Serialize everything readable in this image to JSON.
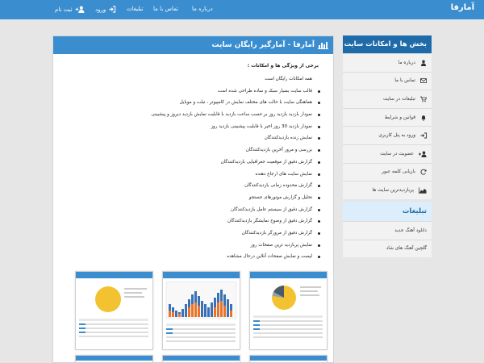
{
  "navbar": {
    "brand": "آمارفا",
    "links": [
      {
        "label": "درباره ما",
        "icon": "none"
      },
      {
        "label": "تماس با ما",
        "icon": "none"
      },
      {
        "label": "تبلیغات",
        "icon": "none"
      },
      {
        "label": "ورود",
        "icon": "sign-in-icon"
      },
      {
        "label": "ثبت نام",
        "icon": "user-plus-icon"
      }
    ]
  },
  "main": {
    "title": "آمارفا - آمارگیر رایگان سایت",
    "title_icon": "bar-chart-icon",
    "intro": "برخی از ویژگی ها و امکانات :",
    "features": [
      "همه امکانات رایگان است",
      "قالب سایت بسیار سبک و ساده طراحی شده است",
      "هماهنگی سایت با حالت های مختلف نمایش در کامپیوتر ، تبلت و موبایل",
      "نمودار بازدید بازدید روز بر حسب ساعت بازدید با قابلیت نمایش بازدید دیروز و پیشبینی",
      "نمودار بازدید 30 روز اخیر با قابلیت پیشبینی بازدید روز",
      "نمایش زنده بازدیدکنندگان",
      "بررسی و مرور آخرین بازدیدکنندگان",
      "گزارش دقیق از موقعیت جغرافیایی بازدیدکنندگان",
      "نمایش سایت های ارجاع دهنده",
      "گزارش محدوده زمانی بازدیدکنندگان",
      "تحلیل و گزارش موتورهای جستجو",
      "گزارش دقیق از سیستم عامل بازدیدکنندگان",
      "گزارش دقیق از وضوح نمایشگر بازدیدکنندگان",
      "گزارش دقیق از مرورگر بازدیدکنندگان",
      "نمایش پربازدید ترین صفحات روز",
      "لیست و نمایش صفحات آنلاین درحال مشاهده"
    ]
  },
  "sidebar": {
    "title": "بخش ها و امکانات سایت",
    "items": [
      {
        "label": "درباره ما",
        "icon": "user-icon"
      },
      {
        "label": "تماس با ما",
        "icon": "envelope-icon"
      },
      {
        "label": "تبلیغات در سایت",
        "icon": "cart-icon"
      },
      {
        "label": "قوانین و شرایط",
        "icon": "bell-icon"
      },
      {
        "label": "ورود به پنل کاربری",
        "icon": "sign-in-icon"
      },
      {
        "label": "عضویت در سایت",
        "icon": "user-plus-icon"
      },
      {
        "label": "بازیابی کلمه عبور",
        "icon": "refresh-icon"
      },
      {
        "label": "پربازدیدترین سایت ها",
        "icon": "area-chart-icon"
      }
    ]
  },
  "ads": {
    "title": "تبلیغات",
    "items": [
      {
        "label": "دانلود آهنگ جدید",
        "icon": "none"
      },
      {
        "label": "گلچین آهنگ های شاد",
        "icon": "none"
      }
    ]
  },
  "colors": {
    "primary": "#3a8dcf",
    "dark_primary": "#1f6aa8",
    "background": "#e6e6e6",
    "chart_gold": "#f2c230"
  }
}
